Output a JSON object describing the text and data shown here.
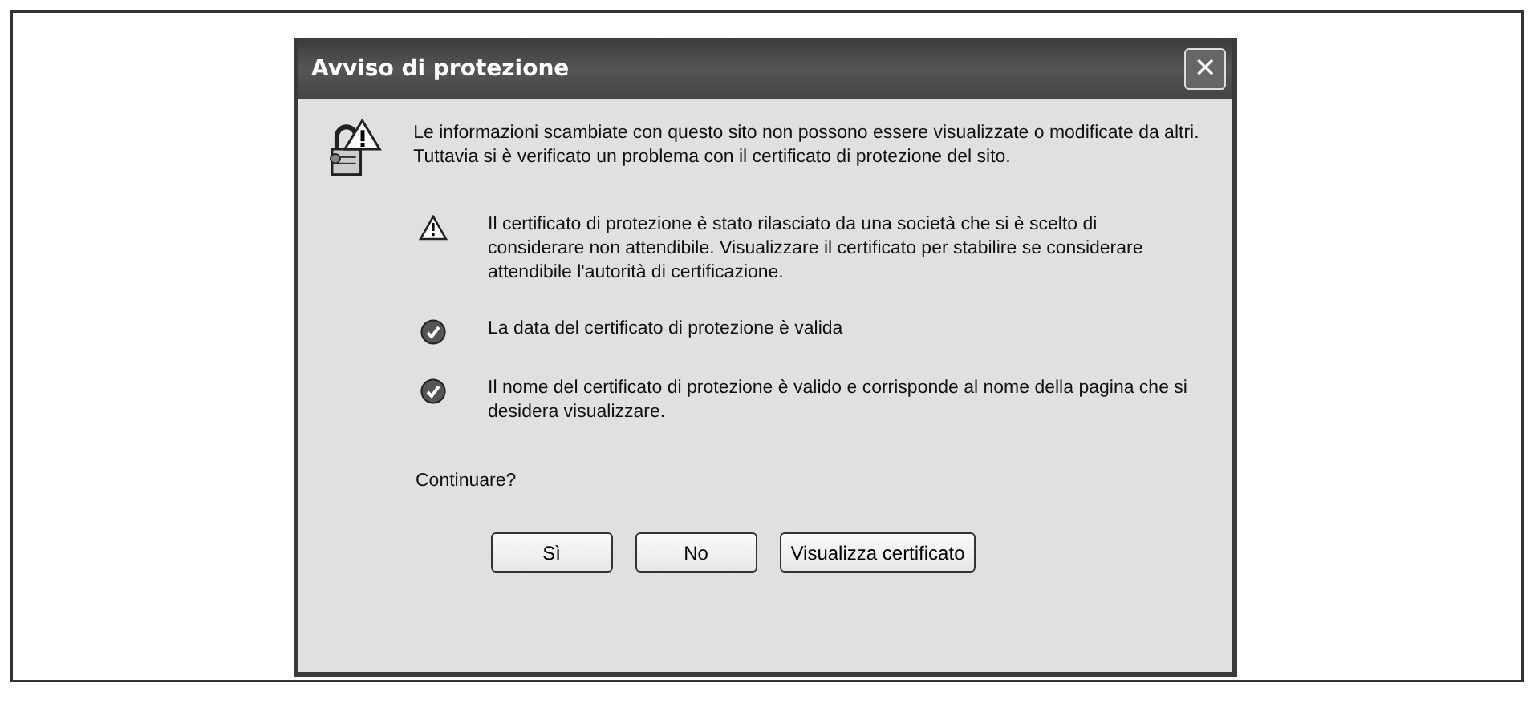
{
  "window": {
    "title": "Avviso di protezione",
    "close": "✕"
  },
  "intro": "Le informazioni scambiate con questo sito non possono essere visualizzate o modificate da altri. Tuttavia si è verificato un problema con il certificato di protezione del sito.",
  "items": [
    {
      "kind": "warning",
      "text": "Il certificato di protezione è stato rilasciato da una società che si è scelto di considerare non attendibile. Visualizzare il certificato per stabilire se considerare attendibile l'autorità di certificazione."
    },
    {
      "kind": "ok",
      "text": "La data del certificato di protezione è valida"
    },
    {
      "kind": "ok",
      "text": "Il nome del certificato di protezione è valido e corrisponde al nome della pagina che si desidera visualizzare."
    }
  ],
  "question": "Continuare?",
  "buttons": [
    "Sì",
    "No",
    "Visualizza certificato"
  ]
}
